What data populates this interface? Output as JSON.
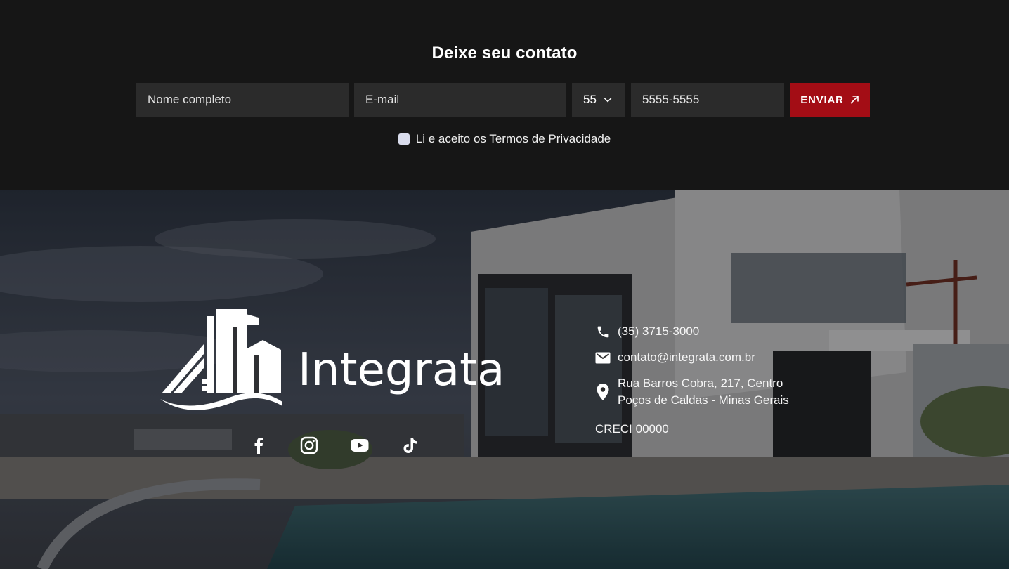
{
  "contact": {
    "title": "Deixe seu contato",
    "name_placeholder": "Nome completo",
    "email_placeholder": "E-mail",
    "ddd_value": "55",
    "phone_placeholder": "5555-5555",
    "send_label": "ENVIAR",
    "terms_label": "Li e aceito os Termos de Privacidade"
  },
  "footer": {
    "brand": "Integrata",
    "phone": "(35) 3715-3000",
    "email": "contato@integrata.com.br",
    "address_line1": "Rua Barros Cobra, 217, Centro",
    "address_line2": "Poços de Caldas - Minas Gerais",
    "creci": "CRECI 00000",
    "socials": [
      "facebook-icon",
      "instagram-icon",
      "youtube-icon",
      "tiktok-icon"
    ]
  },
  "colors": {
    "background": "#161616",
    "input_background": "#2b2b2b",
    "accent": "#a30d15"
  }
}
